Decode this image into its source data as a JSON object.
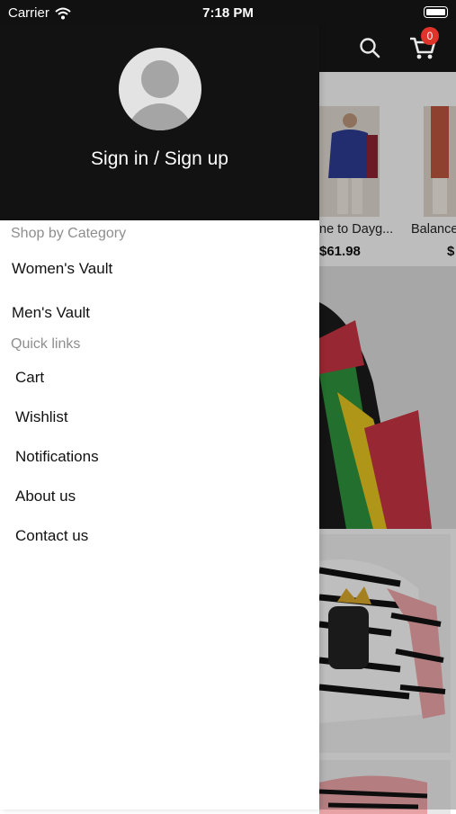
{
  "status_bar": {
    "carrier": "Carrier",
    "time": "7:18 PM"
  },
  "header": {
    "cart_count": "0"
  },
  "background_products": [
    {
      "name": "ne to Dayg...",
      "price": "$61.98"
    },
    {
      "name": "Balance",
      "price": "$"
    }
  ],
  "drawer": {
    "sign_in_label": "Sign in / Sign up",
    "shop_heading": "Shop by Category",
    "categories": [
      "Women's Vault",
      "Men's Vault"
    ],
    "quick_heading": "Quick links",
    "quick_links": [
      "Cart",
      "Wishlist",
      "Notifications",
      "About us",
      "Contact us"
    ]
  }
}
